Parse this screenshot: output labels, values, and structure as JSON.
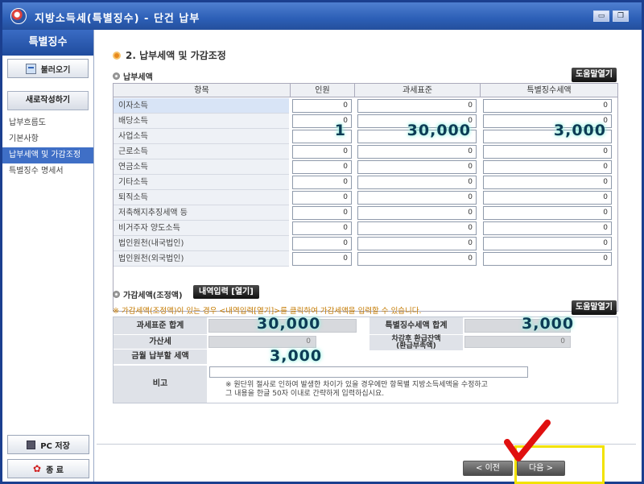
{
  "window": {
    "title": "지방소득세(특별징수) - 단건 납부"
  },
  "sidebar": {
    "header": "특별징수",
    "load_label": "불러오기",
    "new_label": "새로작성하기",
    "items": [
      {
        "label": "납부흐름도"
      },
      {
        "label": "기본사항"
      },
      {
        "label": "납부세액 및 가감조정"
      },
      {
        "label": "특별징수 명세서"
      }
    ],
    "pc_save_label": "PC 저장",
    "exit_label": "종 료"
  },
  "section": {
    "title": "2. 납부세액 및 가감조정",
    "payment_subtitle": "납부세액",
    "help_label": "도움말열기"
  },
  "grid": {
    "headers": [
      "항목",
      "인원",
      "과세표준",
      "특별징수세액"
    ],
    "rows": [
      {
        "label": "이자소득",
        "count": "0",
        "base": "0",
        "tax": "0"
      },
      {
        "label": "배당소득",
        "count": "0",
        "base": "0",
        "tax": "0"
      },
      {
        "label": "사업소득",
        "count": "1",
        "base": "30,000",
        "tax": "3,000"
      },
      {
        "label": "근로소득",
        "count": "0",
        "base": "0",
        "tax": "0"
      },
      {
        "label": "연금소득",
        "count": "0",
        "base": "0",
        "tax": "0"
      },
      {
        "label": "기타소득",
        "count": "0",
        "base": "0",
        "tax": "0"
      },
      {
        "label": "퇴직소득",
        "count": "0",
        "base": "0",
        "tax": "0"
      },
      {
        "label": "저축해지추징세액 등",
        "count": "0",
        "base": "0",
        "tax": "0"
      },
      {
        "label": "비거주자 양도소득",
        "count": "0",
        "base": "0",
        "tax": "0"
      },
      {
        "label": "법인원천(내국법인)",
        "count": "0",
        "base": "0",
        "tax": "0"
      },
      {
        "label": "법인원천(외국법인)",
        "count": "0",
        "base": "0",
        "tax": "0"
      }
    ]
  },
  "adjust": {
    "subtitle": "가감세액(조정액)",
    "detail_button": "내역입력 [열기]",
    "hint": "※ 가감세액(조정액)이 있는 경우 <내역입력[열기]>를 클릭하여 가감세액을 입력할 수 있습니다.",
    "help_label": "도움말열기"
  },
  "summary": {
    "base_total_label": "과세표준 합계",
    "base_total_value": "30,000",
    "tax_total_label": "특별징수세액 합계",
    "tax_total_value": "3,000",
    "penalty_label": "가산세",
    "penalty_value": "0",
    "refund_label_1": "차감후 환급잔액",
    "refund_label_2": "(환급부족액)",
    "refund_value": "0",
    "payable_label": "금월 납부할 세액",
    "payable_value": "3,000",
    "remark_label": "비고",
    "note_line1": "※ 원단위 절사로 인하여 발생한 차이가 있을 경우에만 항목별 지방소득세액을 수정하고",
    "note_line2": "그 내용을 한글 50자 이내로 간략하게 입력하십시요."
  },
  "nav": {
    "prev_label": "< 이전",
    "next_label": "다음 >"
  },
  "colors": {
    "title_bar": "#2c5fb6",
    "highlight_text": "#0d3b55",
    "annotation_box": "#f2e200",
    "check_mark": "#e01010"
  }
}
